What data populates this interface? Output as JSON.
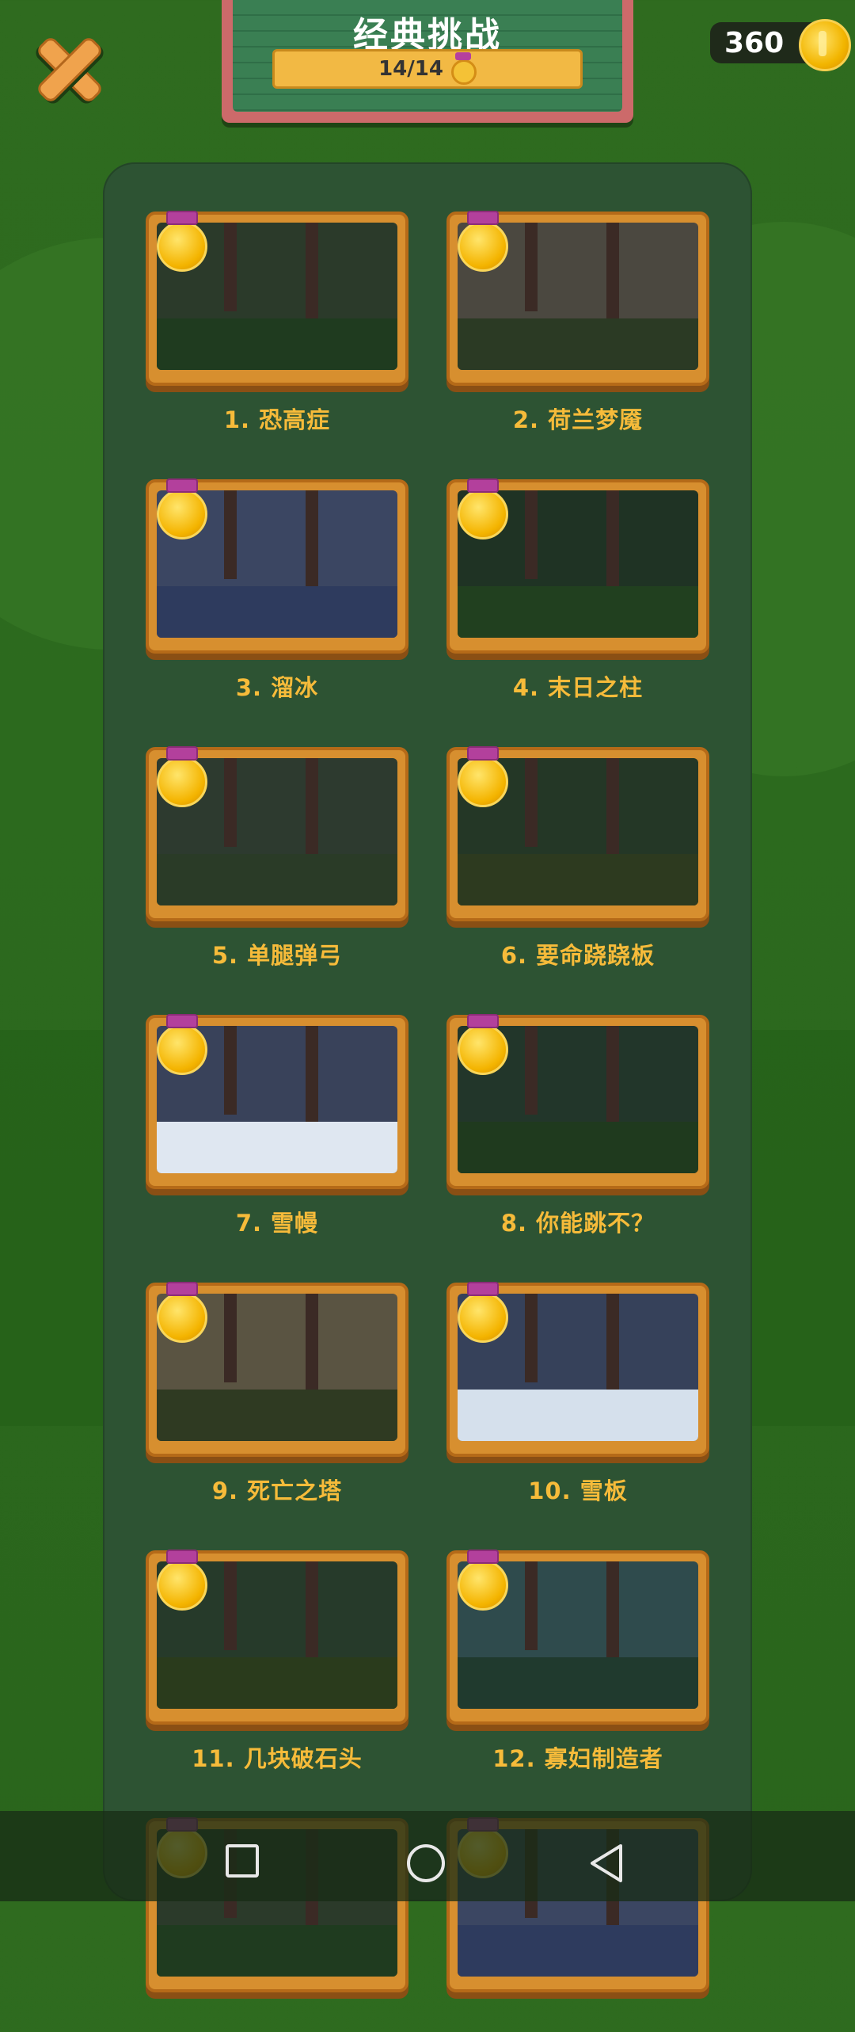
{
  "header": {
    "title": "经典挑战",
    "progress": "14/14",
    "coins": "360"
  },
  "levels": [
    {
      "label": "1. 恐高症",
      "theme": "forest"
    },
    {
      "label": "2. 荷兰梦魇",
      "theme": "windmill"
    },
    {
      "label": "3. 溜冰",
      "theme": "ice"
    },
    {
      "label": "4. 末日之柱",
      "theme": "pillars"
    },
    {
      "label": "5. 单腿弹弓",
      "theme": "slingshot"
    },
    {
      "label": "6. 要命跷跷板",
      "theme": "seesaw"
    },
    {
      "label": "7. 雪幔",
      "theme": "snow"
    },
    {
      "label": "8. 你能跳不？",
      "theme": "posts"
    },
    {
      "label": "9. 死亡之塔",
      "theme": "towers"
    },
    {
      "label": "10. 雪板",
      "theme": "snowboard"
    },
    {
      "label": "11. 几块破石头",
      "theme": "rocks"
    },
    {
      "label": "12. 寡妇制造者",
      "theme": "pines"
    },
    {
      "label": "",
      "theme": "forest"
    },
    {
      "label": "",
      "theme": "ice"
    }
  ],
  "navbar": {
    "recent": "recent-apps-icon",
    "home": "home-icon",
    "back": "back-icon"
  },
  "colors": {
    "label": "#f6bb3a",
    "frame": "#d78f2f",
    "panel": "#2d5333",
    "ribbon": "#b3409c"
  }
}
